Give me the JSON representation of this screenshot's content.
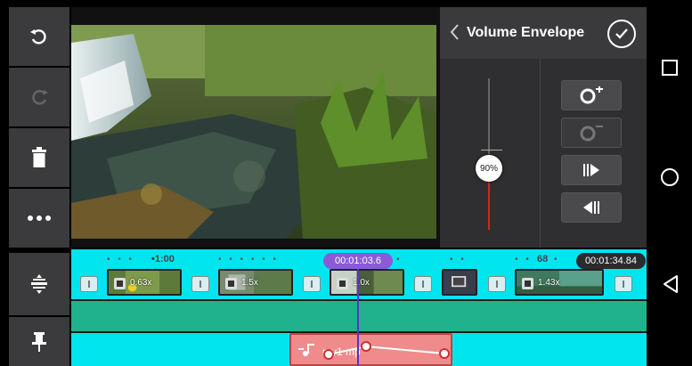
{
  "panel": {
    "title": "Volume Envelope",
    "volume_level": "90%",
    "volume_fraction": 0.9
  },
  "timeline": {
    "ruler_time_1": "1:00",
    "ruler_number": "68",
    "playhead_time": "00:01:03.6",
    "end_time": "00:01:34.84",
    "clips": [
      {
        "label": "0.63x"
      },
      {
        "label": "1.5x"
      },
      {
        "label": "1.0x"
      },
      {
        "label": ""
      },
      {
        "label": "1.43x"
      }
    ],
    "audio_clip_label": "my1 mp"
  },
  "icons": {
    "undo": "undo-icon",
    "redo": "redo-icon",
    "delete": "trash-icon",
    "more": "more-icon",
    "split": "split-icon",
    "pin": "pin-icon",
    "back": "chevron-left-icon",
    "confirm": "check-icon",
    "add_point": "add-keyframe-icon",
    "remove_point": "remove-keyframe-icon",
    "next_point": "next-keyframe-icon",
    "prev_point": "prev-keyframe-icon",
    "music": "music-note-icon"
  },
  "colors": {
    "accent_cyan": "#00e5ee",
    "playhead": "#8a5ad8",
    "audio_clip": "#ef8b8b",
    "volume_fill": "#e02020"
  }
}
